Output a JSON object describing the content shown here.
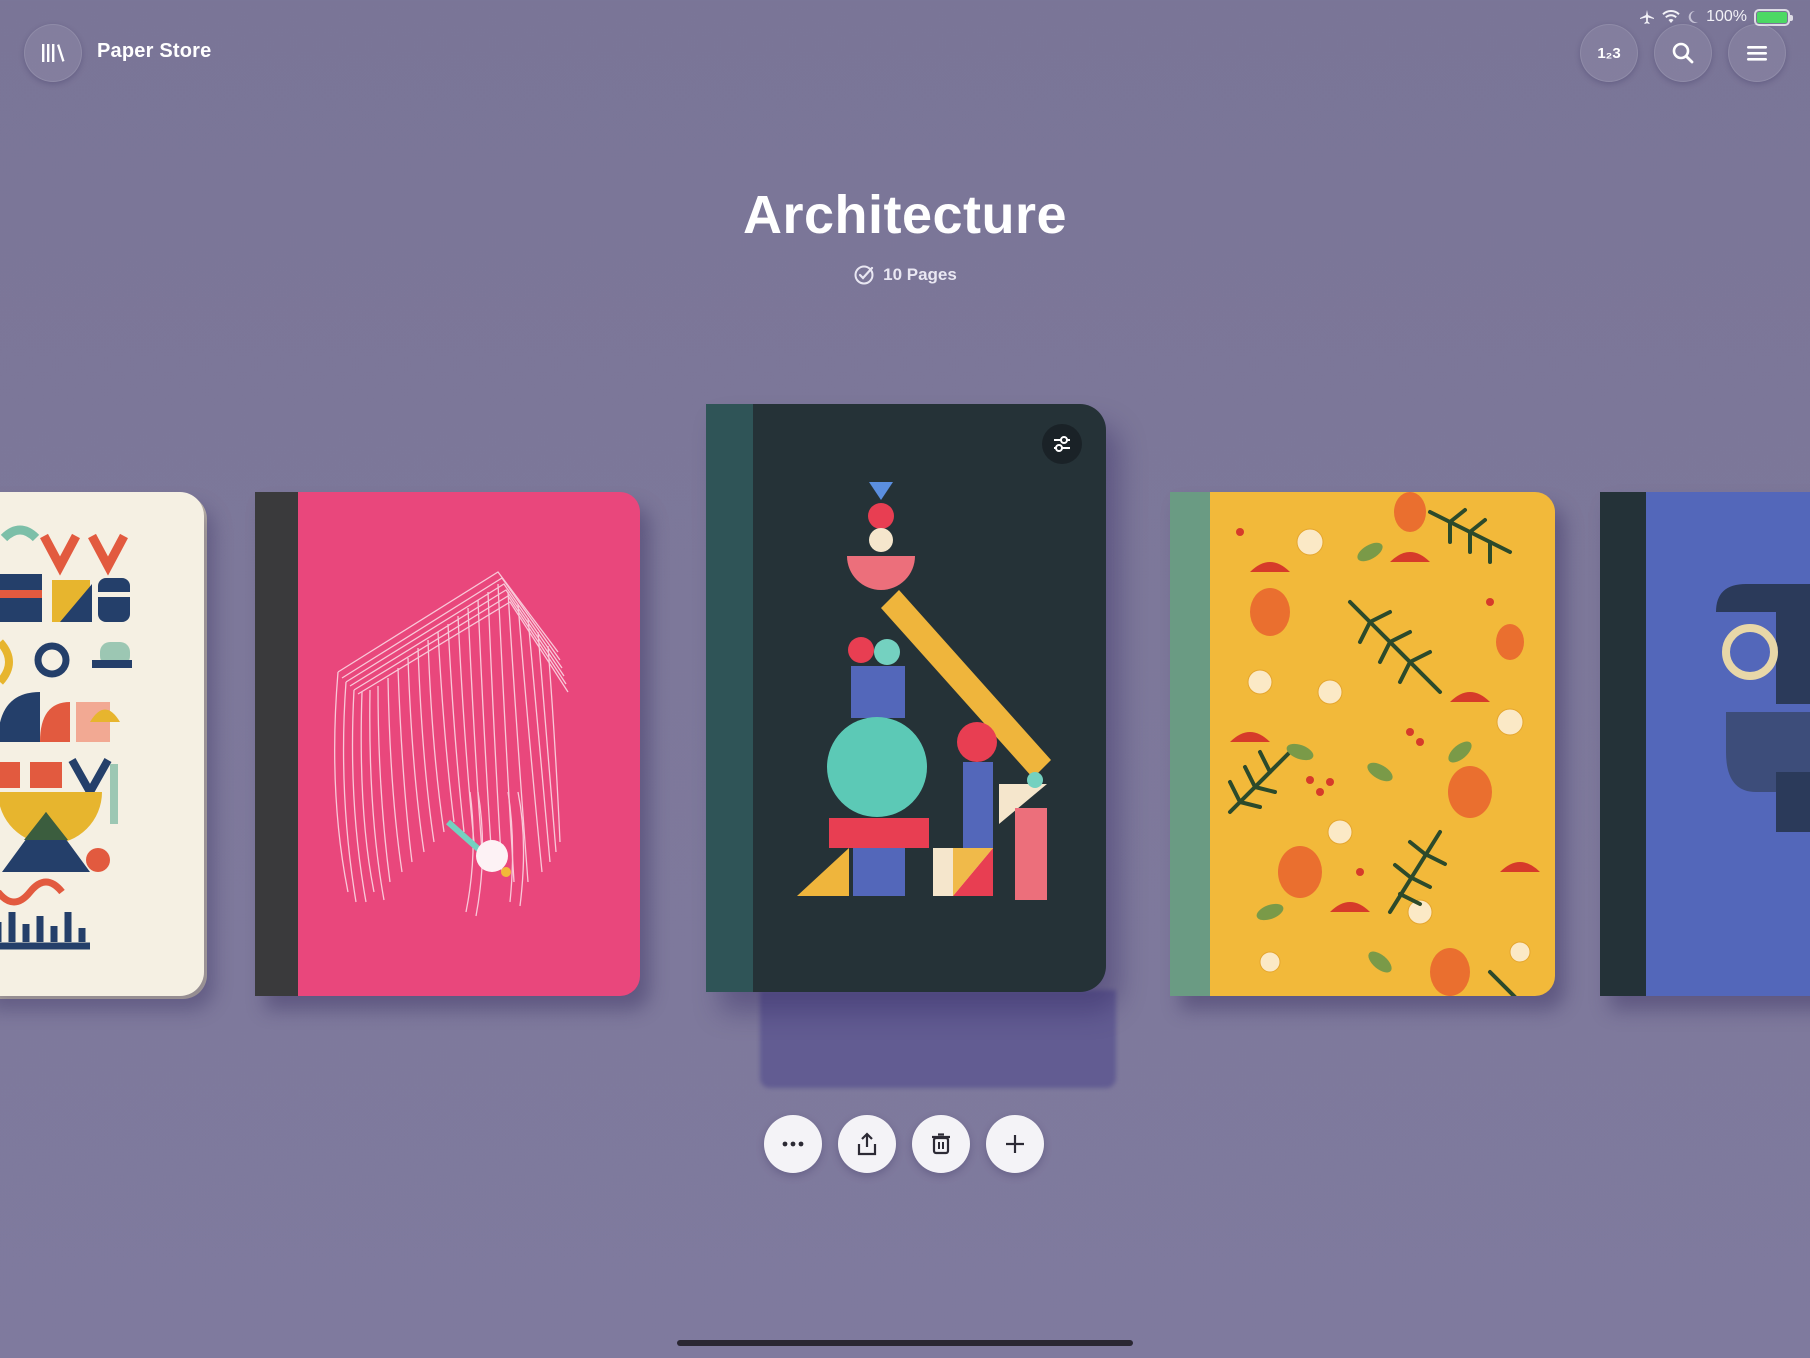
{
  "status_bar": {
    "battery": "100%"
  },
  "header": {
    "app_title": "Paper Store",
    "number_button_label": "1₂3"
  },
  "notebook": {
    "title": "Architecture",
    "page_count_label": "10 Pages"
  },
  "notebooks": [
    {
      "id": "patterned-cream",
      "cover_color": "#f5f0e3"
    },
    {
      "id": "pink-sketch",
      "cover_color": "#e9477c",
      "spine_color": "#3a3a3c"
    },
    {
      "id": "architecture",
      "cover_color": "#253237",
      "spine_color": "#2f5457",
      "selected": true
    },
    {
      "id": "yellow-floral",
      "cover_color": "#f2b93a",
      "spine_color": "#6a9b83"
    },
    {
      "id": "blue-face",
      "cover_color": "#5367ba",
      "spine_color": "#243238"
    }
  ],
  "actions": [
    {
      "icon": "more-icon"
    },
    {
      "icon": "share-icon"
    },
    {
      "icon": "trash-icon"
    },
    {
      "icon": "plus-icon"
    }
  ],
  "colors": {
    "background": "#7d789a",
    "accent_white": "#ffffff"
  }
}
